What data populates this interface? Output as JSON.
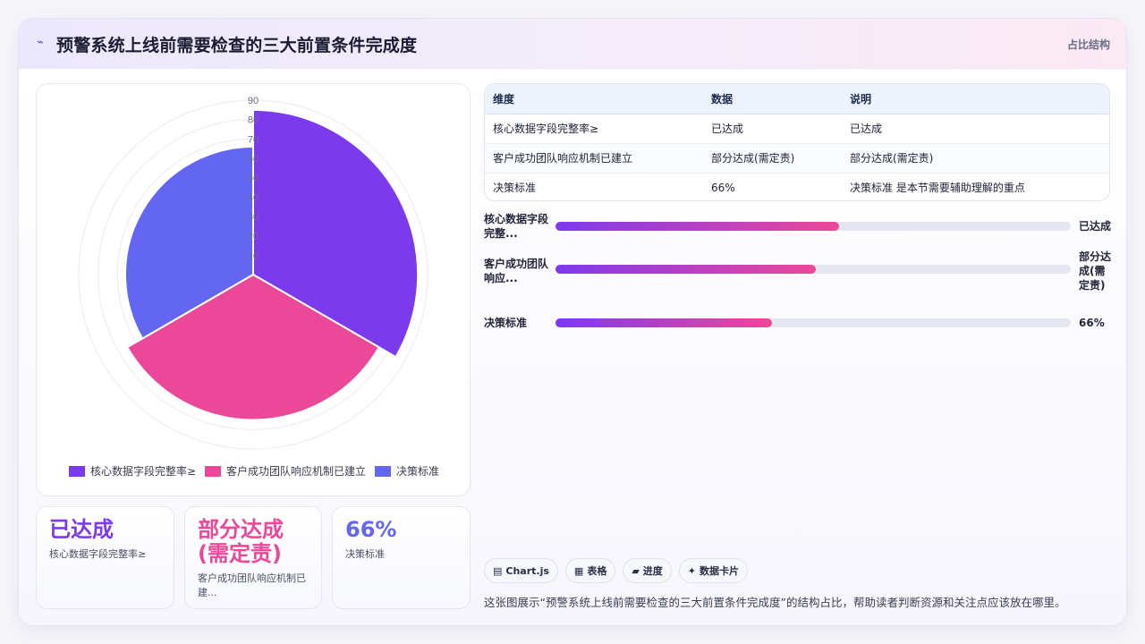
{
  "header": {
    "icon": "spark-icon",
    "title": "预警系统上线前需要检查的三大前置条件完成度",
    "tag": "占比结构"
  },
  "chart_data": {
    "type": "polar-area",
    "categories": [
      "核心数据字段完整率≥",
      "客户成功团队响应机制已建立",
      "决策标准"
    ],
    "values": [
      85,
      75,
      66
    ],
    "colors": [
      "#7c3aed",
      "#ec4899",
      "#6366f1"
    ],
    "r_ticks": [
      "10",
      "20",
      "30",
      "40",
      "50",
      "60",
      "70",
      "80",
      "90"
    ],
    "rlim": [
      0,
      90
    ],
    "legend": "bottom"
  },
  "stats": [
    {
      "value": "已达成",
      "label": "核心数据字段完整率≥",
      "color": "#7c3aed"
    },
    {
      "value": "部分达成(需定责)",
      "label": "客户成功团队响应机制已建...",
      "color": "#ec4899"
    },
    {
      "value": "66%",
      "label": "决策标准",
      "color": "#6366f1"
    }
  ],
  "table": {
    "headers": [
      "维度",
      "数据",
      "说明"
    ],
    "rows": [
      [
        "核心数据字段完整率≥",
        "已达成",
        "已达成"
      ],
      [
        "客户成功团队响应机制已建立",
        "部分达成(需定责)",
        "部分达成(需定责)"
      ],
      [
        "决策标准",
        "66%",
        "决策标准 是本节需要辅助理解的重点"
      ]
    ]
  },
  "progress": [
    {
      "label": "核心数据字段完整...",
      "value_text": "已达成",
      "fraction": 0.55
    },
    {
      "label": "客户成功团队响应...",
      "value_text": "部分达成(需定责)",
      "fraction": 0.505
    },
    {
      "label": "决策标准",
      "value_text": "66%",
      "fraction": 0.42
    }
  ],
  "chips": [
    {
      "icon": "chart-icon",
      "glyph": "▤",
      "label": "Chart.js"
    },
    {
      "icon": "table-icon",
      "glyph": "▦",
      "label": "表格"
    },
    {
      "icon": "progress-icon",
      "glyph": "▰",
      "label": "进度"
    },
    {
      "icon": "sparkle-icon",
      "glyph": "✦",
      "label": "数据卡片"
    }
  ],
  "footnote": "这张图展示“预警系统上线前需要检查的三大前置条件完成度”的结构占比，帮助读者判断资源和关注点应该放在哪里。"
}
